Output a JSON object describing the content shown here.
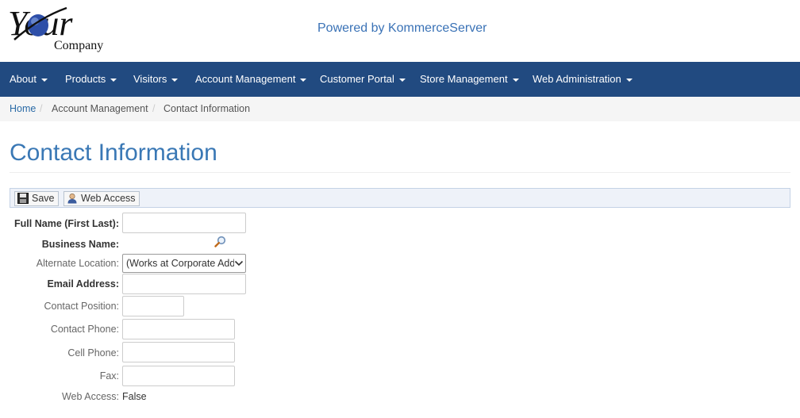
{
  "brand": {
    "logo_text": "Your",
    "logo_subtext": "Company",
    "powered_by": "Powered by KommerceServer"
  },
  "nav": {
    "items": [
      {
        "label": "About"
      },
      {
        "label": "Products"
      },
      {
        "label": "Visitors"
      },
      {
        "label": "Account Management"
      },
      {
        "label": "Customer Portal"
      },
      {
        "label": "Store Management"
      },
      {
        "label": "Web Administration"
      }
    ]
  },
  "breadcrumb": {
    "items": [
      "Home",
      "Account Management",
      "Contact Information"
    ],
    "separator": "/"
  },
  "page": {
    "title": "Contact Information"
  },
  "toolbar": {
    "save_label": "Save",
    "web_access_label": "Web Access"
  },
  "form": {
    "full_name_label": "Full Name (First Last):",
    "full_name_value": "",
    "business_name_label": "Business Name:",
    "alternate_location_label": "Alternate Location:",
    "alternate_location_value": "(Works at Corporate Address)",
    "email_label": "Email Address:",
    "email_value": "",
    "position_label": "Contact Position:",
    "position_value": "",
    "phone_label": "Contact Phone:",
    "phone_value": "",
    "cell_label": "Cell Phone:",
    "cell_value": "",
    "fax_label": "Fax:",
    "fax_value": "",
    "web_access_label": "Web Access:",
    "web_access_value": "False"
  },
  "icons": {
    "save": "floppy-disk-icon",
    "web_access": "user-icon",
    "business_search": "magnifier-icon",
    "dropdown": "chevron-down-icon"
  },
  "colors": {
    "navbar": "#214a80",
    "title": "#3a78b5",
    "link": "#2a6aa6",
    "toolbar_bg": "#eef2f9"
  }
}
